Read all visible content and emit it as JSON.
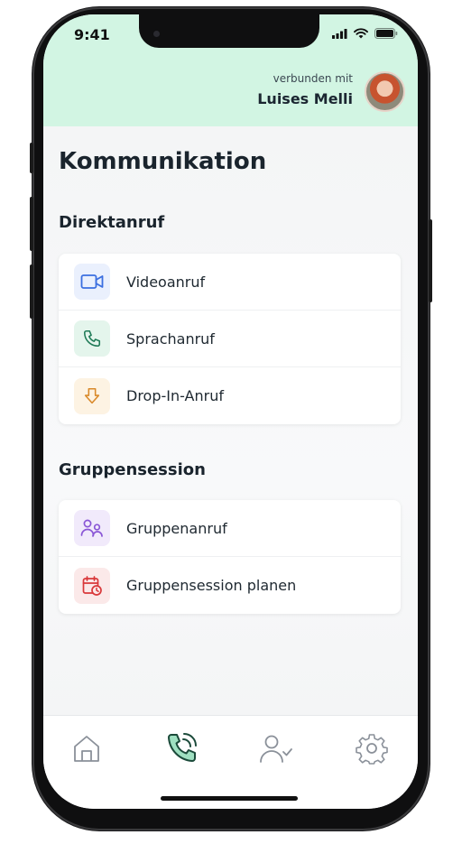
{
  "status_bar": {
    "time": "9:41"
  },
  "header": {
    "connected_label": "verbunden mit",
    "connected_name": "Luises Melli"
  },
  "page_title": "Kommunikation",
  "sections": {
    "direct": {
      "title": "Direktanruf",
      "items": [
        {
          "label": "Videoanruf",
          "icon": "video-camera-icon"
        },
        {
          "label": "Sprachanruf",
          "icon": "phone-icon"
        },
        {
          "label": "Drop-In-Anruf",
          "icon": "arrow-down-icon"
        }
      ]
    },
    "group": {
      "title": "Gruppensession",
      "items": [
        {
          "label": "Gruppenanruf",
          "icon": "users-icon"
        },
        {
          "label": "Gruppensession planen",
          "icon": "calendar-clock-icon"
        }
      ]
    }
  },
  "tabbar": {
    "items": [
      {
        "icon": "home-icon",
        "active": false
      },
      {
        "icon": "phone-call-icon",
        "active": true
      },
      {
        "icon": "user-check-icon",
        "active": false
      },
      {
        "icon": "gear-icon",
        "active": false
      }
    ]
  },
  "colors": {
    "header_bg": "#d2f5e3",
    "video": "#3b6fe0",
    "phone": "#1e7a56",
    "dropin": "#d9892a",
    "group": "#8a56d6",
    "calendar": "#d9383a"
  }
}
